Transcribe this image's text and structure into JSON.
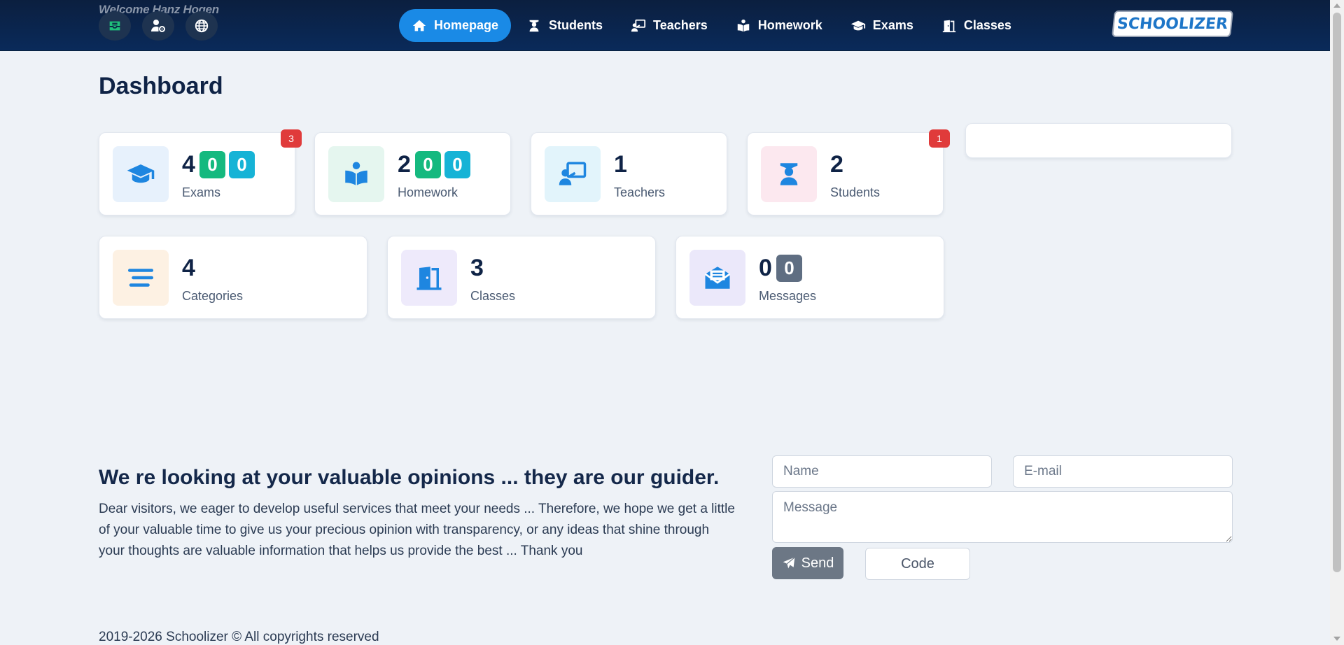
{
  "header": {
    "welcome_text": "Welcome Hanz Hogen",
    "quick_icons": [
      "inbox-icon",
      "user-settings-icon",
      "globe-icon"
    ],
    "nav": [
      {
        "label": "Homepage",
        "icon": "home-icon",
        "active": true
      },
      {
        "label": "Students",
        "icon": "student-icon",
        "active": false
      },
      {
        "label": "Teachers",
        "icon": "teacher-icon",
        "active": false
      },
      {
        "label": "Homework",
        "icon": "homework-icon",
        "active": false
      },
      {
        "label": "Exams",
        "icon": "graduation-cap-icon",
        "active": false
      },
      {
        "label": "Classes",
        "icon": "door-icon",
        "active": false
      }
    ],
    "logo_text": "SCHOOLIZER"
  },
  "page": {
    "title": "Dashboard"
  },
  "cards": {
    "exams": {
      "count": "4",
      "chip1": "0",
      "chip2": "0",
      "label": "Exams",
      "badge": "3",
      "icon": "graduation-cap-icon",
      "color": "#1e86e0"
    },
    "homework": {
      "count": "2",
      "chip1": "0",
      "chip2": "0",
      "label": "Homework",
      "icon": "homework-icon",
      "color": "#1e86e0"
    },
    "teachers": {
      "count": "1",
      "label": "Teachers",
      "icon": "teacher-icon",
      "color": "#1e86e0"
    },
    "students": {
      "count": "2",
      "label": "Students",
      "badge": "1",
      "icon": "student-icon",
      "color": "#1e86e0"
    },
    "categories": {
      "count": "4",
      "label": "Categories",
      "icon": "list-icon",
      "color": "#1e86e0"
    },
    "classes": {
      "count": "3",
      "label": "Classes",
      "icon": "door-icon",
      "color": "#1e86e0"
    },
    "messages": {
      "count": "0",
      "chip1": "0",
      "label": "Messages",
      "icon": "envelope-icon",
      "color": "#1e86e0"
    }
  },
  "feedback": {
    "heading": "We re looking at your valuable opinions ... they are our guider.",
    "text": "Dear visitors, we eager to develop useful services that meet your needs ... Therefore, we hope we get a little of your valuable time to give us your precious opinion with transparency, or any ideas that shine through your thoughts are valuable information that helps us provide the best ... Thank you",
    "name_placeholder": "Name",
    "email_placeholder": "E-mail",
    "message_placeholder": "Message",
    "send_label": "Send",
    "code_label": "Code"
  },
  "footer": {
    "text": "2019-2026 Schoolizer © All copyrights reserved"
  }
}
